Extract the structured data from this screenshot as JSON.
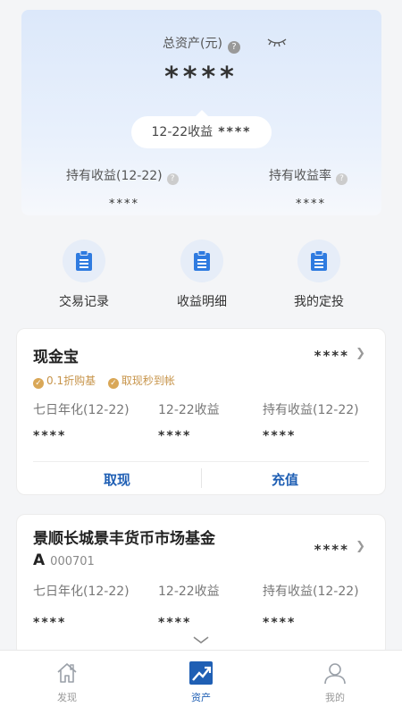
{
  "summary": {
    "total_assets_label": "总资产(元)",
    "total_assets_value": "****",
    "daily_income_label": "12-22收益",
    "daily_income_value": "****",
    "holding_income_label": "持有收益(12-22)",
    "holding_income_value": "****",
    "holding_rate_label": "持有收益率",
    "holding_rate_value": "****"
  },
  "shortcuts": [
    {
      "label": "交易记录",
      "icon": "clipboard-icon"
    },
    {
      "label": "收益明细",
      "icon": "clipboard-icon"
    },
    {
      "label": "我的定投",
      "icon": "clipboard-icon"
    }
  ],
  "cash_card": {
    "title": "现金宝",
    "value": "****",
    "tags": [
      "0.1折购基",
      "取现秒到帐"
    ],
    "columns": [
      {
        "label": "七日年化(12-22)",
        "value": "****"
      },
      {
        "label": "12-22收益",
        "value": "****"
      },
      {
        "label": "持有收益(12-22)",
        "value": "****"
      }
    ],
    "withdraw_label": "取现",
    "deposit_label": "充值"
  },
  "fund_card": {
    "title": "景顺长城景丰货币市场基金A",
    "code": "000701",
    "value": "****",
    "columns": [
      {
        "label": "七日年化(12-22)",
        "value": "****"
      },
      {
        "label": "12-22收益",
        "value": "****"
      },
      {
        "label": "持有收益(12-22)",
        "value": "****"
      }
    ]
  },
  "tabbar": {
    "items": [
      {
        "label": "发现",
        "icon": "home-icon"
      },
      {
        "label": "资产",
        "icon": "trend-chart-icon"
      },
      {
        "label": "我的",
        "icon": "user-icon"
      }
    ],
    "active_index": 1
  },
  "colors": {
    "accent": "#1f5fb4",
    "tag": "#c7944a",
    "hero_top": "#dce8fa"
  }
}
